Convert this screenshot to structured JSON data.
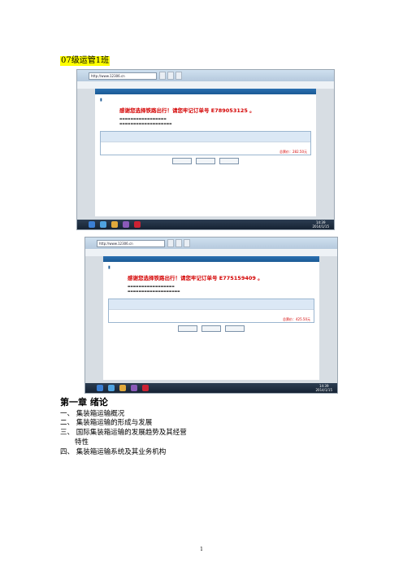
{
  "doc": {
    "heading": "07级运管1班",
    "chapter_title": "第一章  绪论",
    "toc": [
      {
        "num": "一、",
        "text": "集装箱运输概况"
      },
      {
        "num": "二、",
        "text": "集装箱运输的形成与发展"
      },
      {
        "num": "三、",
        "text": "国际集装箱运输的发展趋势及其经营"
      },
      {
        "num": "",
        "text": "特性"
      },
      {
        "num": "四、",
        "text": "集装箱运输系统及其业务机构"
      }
    ],
    "page_number": "1"
  },
  "screenshots": [
    {
      "url": "http://www.12306.cn",
      "thanks": "感谢您选择铁路出行！请您牢记订单号 E789053125 。",
      "total": "总票价：282.50元",
      "clock_time": "14:39",
      "clock_date": "2014/1/15"
    },
    {
      "url": "http://www.12306.cn",
      "thanks": "感谢您选择铁路出行！请您牢记订单号 E775159409 。",
      "total": "总票价：425.50元",
      "clock_time": "14:39",
      "clock_date": "2014/1/15"
    }
  ],
  "colors": {
    "highlight": "#ffff00",
    "accent_red": "#d40000",
    "brand_blue": "#1b5a95"
  }
}
